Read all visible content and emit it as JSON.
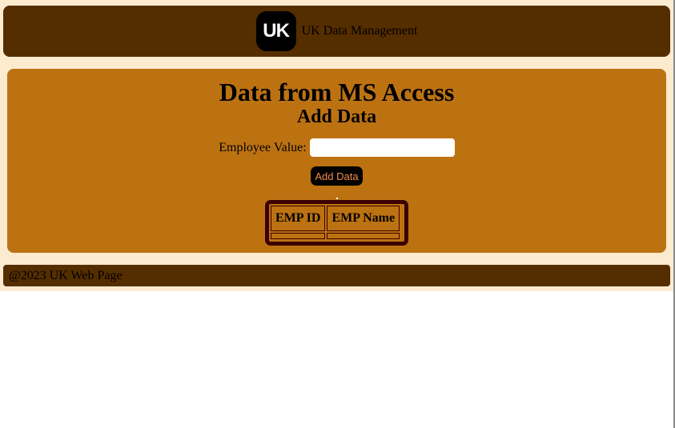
{
  "header": {
    "logo_text": "UK",
    "title": "UK Data Management"
  },
  "main": {
    "heading": "Data from MS Access",
    "subheading": "Add Data",
    "form": {
      "label": "Employee Value:",
      "value": "",
      "button_label": "Add Data"
    },
    "table": {
      "columns": [
        "EMP ID",
        "EMP Name"
      ],
      "rows": [
        [
          "",
          ""
        ]
      ]
    }
  },
  "footer": {
    "text": "@2023 UK Web Page"
  },
  "colors": {
    "page_background": "#fdebd0",
    "header_background": "#552e00",
    "main_background": "#bd7212",
    "table_border": "#3b0000",
    "button_background": "#000000",
    "button_text": "#f08a4b"
  }
}
